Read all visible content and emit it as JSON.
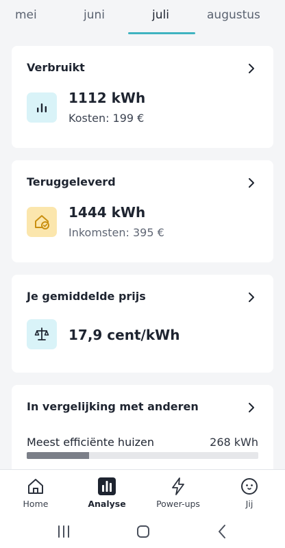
{
  "months": [
    "mei",
    "juni",
    "juli",
    "augustus"
  ],
  "active_month": "juli",
  "consumed": {
    "title": "Verbruikt",
    "value": "1112 kWh",
    "sub": "Kosten: 199 €"
  },
  "returned": {
    "title": "Teruggeleverd",
    "value": "1444 kWh",
    "sub": "Inkomsten: 395 €"
  },
  "avg_price": {
    "title": "Je gemiddelde prijs",
    "value": "17,9 cent/kWh"
  },
  "comparison": {
    "title": "In vergelijking met anderen",
    "row_label": "Meest efficiënte huizen",
    "row_value": "268 kWh",
    "bar_fraction": 0.27
  },
  "nav": [
    {
      "label": "Home",
      "icon": "home-icon"
    },
    {
      "label": "Analyse",
      "icon": "analysis-icon"
    },
    {
      "label": "Power-ups",
      "icon": "lightning-icon"
    },
    {
      "label": "Jij",
      "icon": "profile-face-icon"
    }
  ],
  "active_nav": "Analyse",
  "colors": {
    "accent": "#3fb3c1",
    "icon_blue_bg": "#d9f3f8",
    "icon_yellow_bg": "#fbe6ad"
  }
}
